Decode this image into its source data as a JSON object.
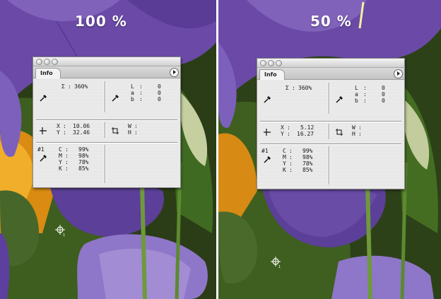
{
  "views": [
    {
      "zoom_label": "100 %",
      "info_panel": {
        "tab_label": "Info",
        "primary": {
          "sigma_label": "Σ",
          "sigma_value": "360%"
        },
        "lab": [
          {
            "label": "L",
            "value": "0"
          },
          {
            "label": "a",
            "value": "0"
          },
          {
            "label": "b",
            "value": "0"
          }
        ],
        "position": [
          {
            "label": "X",
            "value": "10.06"
          },
          {
            "label": "Y",
            "value": "32.46"
          }
        ],
        "size": [
          {
            "label": "W",
            "value": ""
          },
          {
            "label": "H",
            "value": ""
          }
        ],
        "sampler_id": "#1",
        "cmyk": [
          {
            "label": "C",
            "value": "99%"
          },
          {
            "label": "M",
            "value": "98%"
          },
          {
            "label": "Y",
            "value": "78%"
          },
          {
            "label": "K",
            "value": "85%"
          }
        ]
      }
    },
    {
      "zoom_label": "50 %",
      "info_panel": {
        "tab_label": "Info",
        "primary": {
          "sigma_label": "Σ",
          "sigma_value": "360%"
        },
        "lab": [
          {
            "label": "L",
            "value": "0"
          },
          {
            "label": "a",
            "value": "0"
          },
          {
            "label": "b",
            "value": "0"
          }
        ],
        "position": [
          {
            "label": "X",
            "value": "5.12"
          },
          {
            "label": "Y",
            "value": "16.27"
          }
        ],
        "size": [
          {
            "label": "W",
            "value": ""
          },
          {
            "label": "H",
            "value": ""
          }
        ],
        "sampler_id": "#1",
        "cmyk": [
          {
            "label": "C",
            "value": "99%"
          },
          {
            "label": "M",
            "value": "98%"
          },
          {
            "label": "Y",
            "value": "78%"
          },
          {
            "label": "K",
            "value": "85%"
          }
        ]
      }
    }
  ],
  "icons": {
    "eyedropper": "eyedropper-icon",
    "crosshair": "crosshair-icon",
    "selection": "selection-size-icon",
    "color_sampler": "color-sampler-icon",
    "color_sampler_cursor": "color-sampler-cursor-icon",
    "panel_menu": "panel-menu-arrow-icon"
  },
  "colors": {
    "petal": "#6a4aa6",
    "petal_dark": "#3e2774",
    "petal_light": "#a48fd0",
    "leaf": "#4f7a2b",
    "leaf_dark": "#22360f",
    "orange": "#e09a1a",
    "panel_bg": "#e9e9e9"
  }
}
